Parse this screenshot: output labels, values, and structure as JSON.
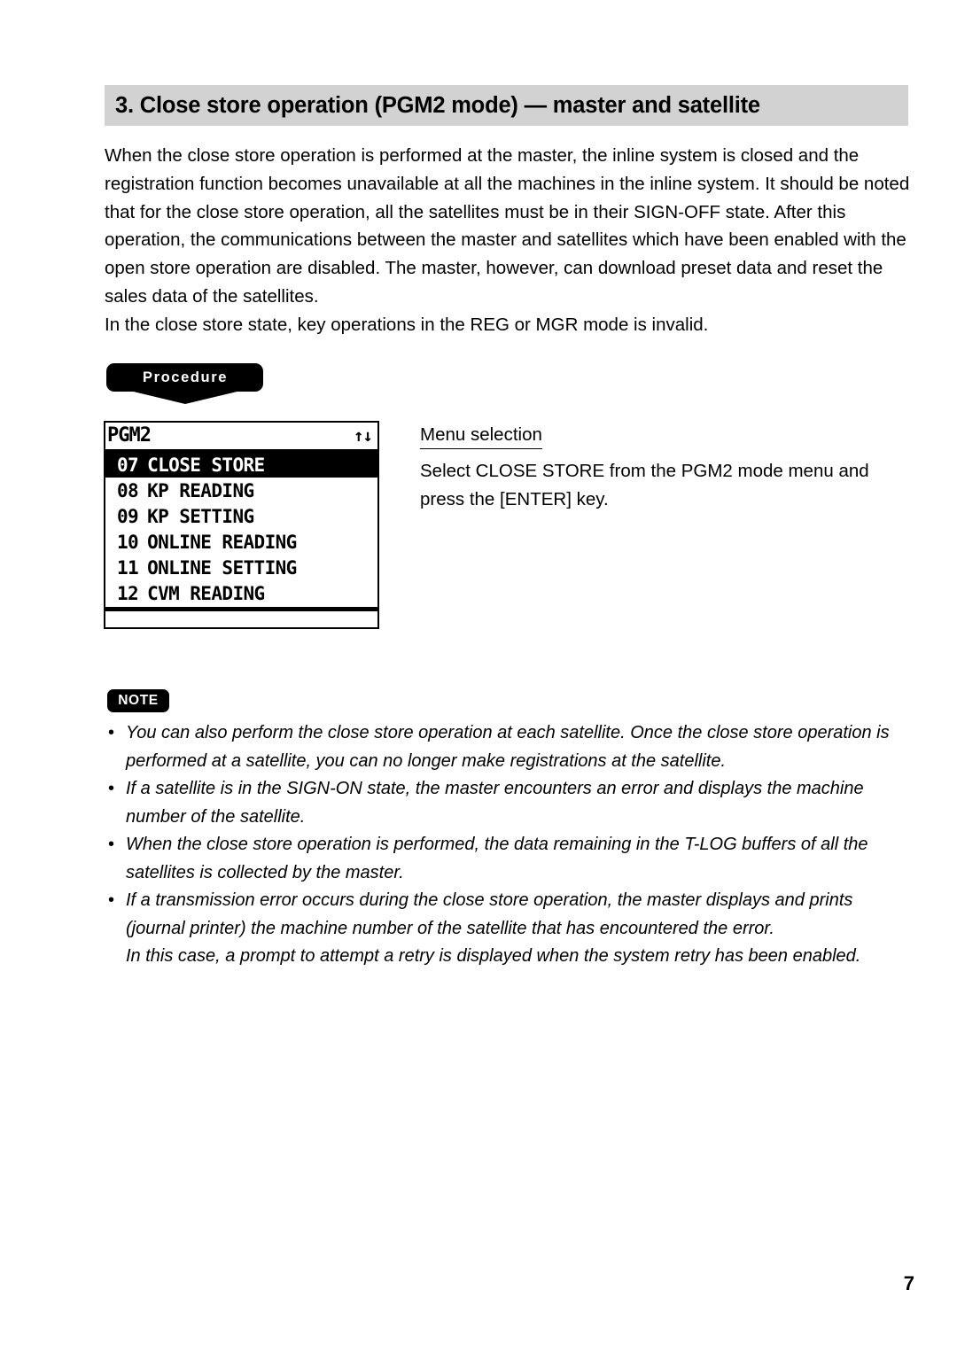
{
  "section": {
    "title": "3.  Close store operation (PGM2 mode) — master and satellite"
  },
  "intro": {
    "paragraph_1": "When the close store operation is performed at the master, the inline system is closed and the registration function becomes unavailable at all the machines in the inline system. It should be noted that for the close store operation, all the satellites must be in their SIGN-OFF state. After this operation, the communications between the master and satellites which have been enabled with the open store operation are disabled. The master, however, can download preset data and reset the sales data of the satellites.",
    "paragraph_2": "In the close store state, key operations in the REG or MGR mode is invalid."
  },
  "procedure": {
    "banner_label": "Procedure"
  },
  "lcd": {
    "mode_label": "PGM2",
    "scroll_arrows": "↑↓",
    "rows": [
      {
        "num": "07",
        "label": "CLOSE STORE",
        "selected": true
      },
      {
        "num": "08",
        "label": "KP READING",
        "selected": false
      },
      {
        "num": "09",
        "label": "KP SETTING",
        "selected": false
      },
      {
        "num": "10",
        "label": "ONLINE READING",
        "selected": false
      },
      {
        "num": "11",
        "label": "ONLINE SETTING",
        "selected": false
      },
      {
        "num": "12",
        "label": "CVM READING",
        "selected": false
      }
    ],
    "entry_value": ""
  },
  "step": {
    "heading": "Menu selection",
    "text": "Select CLOSE STORE from the PGM2 mode menu and press the [ENTER] key."
  },
  "note": {
    "badge_label": "NOTE",
    "bullet_char": "•",
    "items": [
      "You can also perform the close store operation at each satellite. Once the close store operation is performed at a satellite, you can no longer make registrations at the satellite.",
      "If a satellite is in the SIGN-ON state, the master encounters an error and displays the machine number of the satellite.",
      "When the close store operation is performed, the data remaining in the T-LOG buffers of all the satellites is collected by the master.",
      "If a transmission error occurs during the close store operation, the master displays and prints (journal printer) the machine number of the satellite that has encountered the error."
    ],
    "item_4_continuation": "In this case, a prompt to attempt a retry is displayed when the system retry has been enabled."
  },
  "footer": {
    "page_number": "7"
  }
}
